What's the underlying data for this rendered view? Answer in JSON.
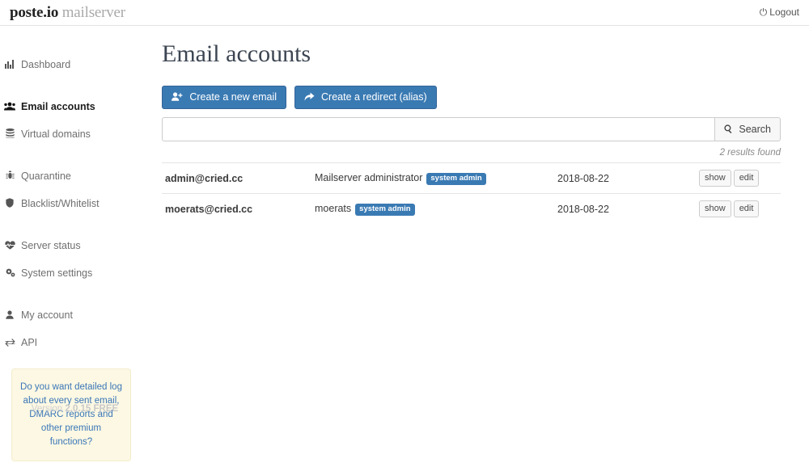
{
  "header": {
    "brand_dark": "poste.io",
    "brand_gray": "mailserver",
    "logout_label": "Logout",
    "logout_icon": "power-off-icon"
  },
  "sidebar": {
    "items": [
      {
        "label": "Dashboard",
        "icon": "bar-chart-icon",
        "active": false
      },
      {
        "label": "Email accounts",
        "icon": "users-icon",
        "active": true
      },
      {
        "label": "Virtual domains",
        "icon": "server-icon",
        "active": false
      },
      {
        "label": "Quarantine",
        "icon": "bug-icon",
        "active": false
      },
      {
        "label": "Blacklist/Whitelist",
        "icon": "shield-icon",
        "active": false
      },
      {
        "label": "Server status",
        "icon": "heartbeat-icon",
        "active": false
      },
      {
        "label": "System settings",
        "icon": "cogs-icon",
        "active": false
      },
      {
        "label": "My account",
        "icon": "user-icon",
        "active": false
      },
      {
        "label": "API",
        "icon": "exchange-icon",
        "active": false
      }
    ],
    "promo": {
      "text": "Do you want detailed log about every sent email, DMARC reports and other premium functions?",
      "link_color": "#3a76b8",
      "background": "#fcf8e3"
    },
    "footer": {
      "version_prefix": "Version",
      "version_value": "2.0.15 FREE"
    }
  },
  "main": {
    "title": "Email accounts",
    "buttons": [
      {
        "label": "Create a new email",
        "icon": "user-plus-icon"
      },
      {
        "label": "Create a redirect (alias)",
        "icon": "share-arrow-icon"
      }
    ],
    "search": {
      "value": "",
      "placeholder": "",
      "button_label": "Search",
      "button_icon": "search-icon"
    },
    "results_text": "2 results found",
    "table": {
      "rows": [
        {
          "email": "admin@cried.cc",
          "name": "Mailserver administrator",
          "badge": "system admin",
          "date": "2018-08-22",
          "actions": [
            "show",
            "edit"
          ]
        },
        {
          "email": "moerats@cried.cc",
          "name": "moerats",
          "badge": "system admin",
          "date": "2018-08-22",
          "actions": [
            "show",
            "edit"
          ]
        }
      ]
    }
  },
  "colors": {
    "accent": "#3a7ab3",
    "badge": "#3a7ab3",
    "promo_bg": "#fcf8e3",
    "text": "#333333"
  }
}
